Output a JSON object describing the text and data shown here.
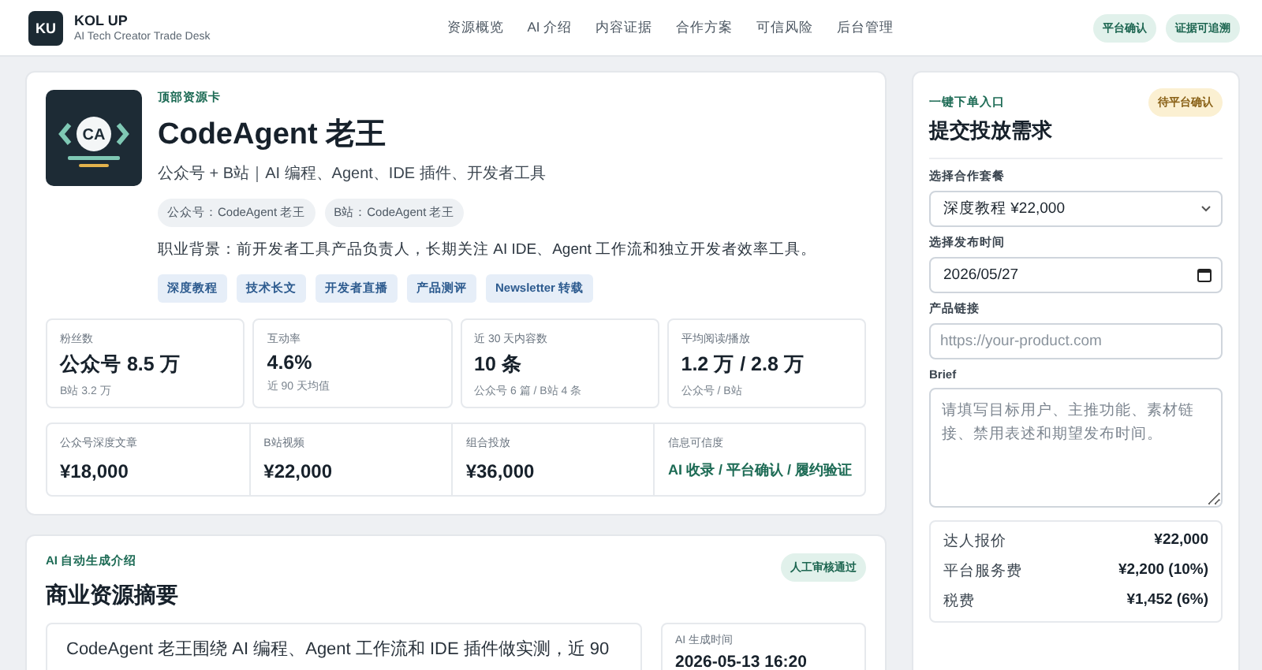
{
  "header": {
    "logo": "KU",
    "brand": "KOL UP",
    "tagline": "AI Tech Creator Trade Desk",
    "nav": [
      "资源概览",
      "AI 介绍",
      "内容证据",
      "合作方案",
      "可信风险",
      "后台管理"
    ],
    "badges": [
      "平台确认",
      "证据可追溯"
    ]
  },
  "profile": {
    "eyebrow": "顶部资源卡",
    "avatar_text": "CA",
    "name": "CodeAgent 老王",
    "subtitle": "公众号 + B站｜AI 编程、Agent、IDE 插件、开发者工具",
    "accounts": [
      "公众号：CodeAgent 老王",
      "B站：CodeAgent 老王"
    ],
    "background": "职业背景：前开发者工具产品负责人，长期关注 AI IDE、Agent 工作流和独立开发者效率工具。",
    "tags": [
      "深度教程",
      "技术长文",
      "开发者直播",
      "产品测评",
      "Newsletter 转载"
    ],
    "stats": [
      {
        "label": "粉丝数",
        "value": "公众号 8.5 万",
        "note": "B站 3.2 万"
      },
      {
        "label": "互动率",
        "value": "4.6%",
        "note": "近 90 天均值"
      },
      {
        "label": "近 30 天内容数",
        "value": "10 条",
        "note": "公众号 6 篇 / B站 4 条"
      },
      {
        "label": "平均阅读/播放",
        "value": "1.2 万 / 2.8 万",
        "note": "公众号 / B站"
      }
    ],
    "prices": [
      {
        "label": "公众号深度文章",
        "value": "¥18,000",
        "kind": "price"
      },
      {
        "label": "B站视频",
        "value": "¥22,000",
        "kind": "price"
      },
      {
        "label": "组合投放",
        "value": "¥36,000",
        "kind": "price"
      },
      {
        "label": "信息可信度",
        "value": "AI 收录 / 平台确认 / 履约验证",
        "kind": "trust"
      }
    ]
  },
  "summary": {
    "eyebrow": "AI 自动生成介绍",
    "badge": "人工审核通过",
    "title": "商业资源摘要",
    "text": "CodeAgent 老王围绕 AI 编程、Agent 工作流和 IDE 插件做实测，近 90",
    "meta_label": "AI 生成时间",
    "meta_value": "2026-05-13 16:20"
  },
  "order": {
    "eyebrow": "一键下单入口",
    "badge": "待平台确认",
    "title": "提交投放需求",
    "fields": [
      {
        "label": "选择合作套餐",
        "kind": "select",
        "value": "深度教程 ¥22,000"
      },
      {
        "label": "选择发布时间",
        "kind": "date",
        "value": "2026/05/27"
      },
      {
        "label": "产品链接",
        "kind": "text",
        "placeholder": "https://your-product.com"
      },
      {
        "label": "Brief",
        "kind": "textarea",
        "placeholder": "请填写目标用户、主推功能、素材链接、禁用表述和期望发布时间。"
      }
    ],
    "costs": [
      {
        "label": "达人报价",
        "value": "¥22,000"
      },
      {
        "label": "平台服务费",
        "value": "¥2,200 (10%)"
      },
      {
        "label": "税费",
        "value": "¥1,452 (6%)"
      }
    ]
  }
}
